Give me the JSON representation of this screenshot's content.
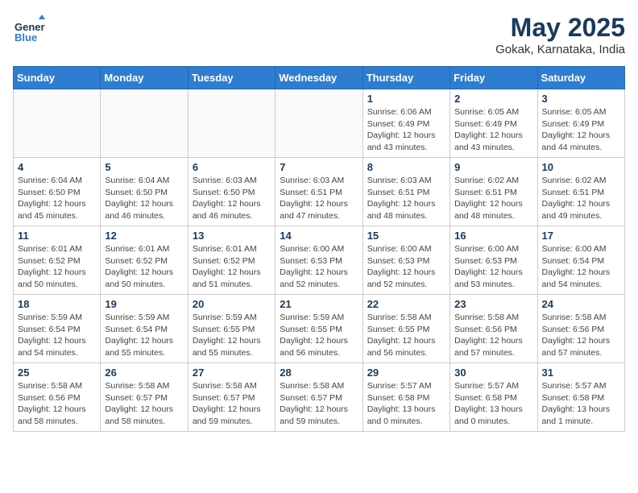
{
  "header": {
    "logo_general": "General",
    "logo_blue": "Blue",
    "month": "May 2025",
    "location": "Gokak, Karnataka, India"
  },
  "days_of_week": [
    "Sunday",
    "Monday",
    "Tuesday",
    "Wednesday",
    "Thursday",
    "Friday",
    "Saturday"
  ],
  "weeks": [
    [
      {
        "day": "",
        "info": ""
      },
      {
        "day": "",
        "info": ""
      },
      {
        "day": "",
        "info": ""
      },
      {
        "day": "",
        "info": ""
      },
      {
        "day": "1",
        "info": "Sunrise: 6:06 AM\nSunset: 6:49 PM\nDaylight: 12 hours\nand 43 minutes."
      },
      {
        "day": "2",
        "info": "Sunrise: 6:05 AM\nSunset: 6:49 PM\nDaylight: 12 hours\nand 43 minutes."
      },
      {
        "day": "3",
        "info": "Sunrise: 6:05 AM\nSunset: 6:49 PM\nDaylight: 12 hours\nand 44 minutes."
      }
    ],
    [
      {
        "day": "4",
        "info": "Sunrise: 6:04 AM\nSunset: 6:50 PM\nDaylight: 12 hours\nand 45 minutes."
      },
      {
        "day": "5",
        "info": "Sunrise: 6:04 AM\nSunset: 6:50 PM\nDaylight: 12 hours\nand 46 minutes."
      },
      {
        "day": "6",
        "info": "Sunrise: 6:03 AM\nSunset: 6:50 PM\nDaylight: 12 hours\nand 46 minutes."
      },
      {
        "day": "7",
        "info": "Sunrise: 6:03 AM\nSunset: 6:51 PM\nDaylight: 12 hours\nand 47 minutes."
      },
      {
        "day": "8",
        "info": "Sunrise: 6:03 AM\nSunset: 6:51 PM\nDaylight: 12 hours\nand 48 minutes."
      },
      {
        "day": "9",
        "info": "Sunrise: 6:02 AM\nSunset: 6:51 PM\nDaylight: 12 hours\nand 48 minutes."
      },
      {
        "day": "10",
        "info": "Sunrise: 6:02 AM\nSunset: 6:51 PM\nDaylight: 12 hours\nand 49 minutes."
      }
    ],
    [
      {
        "day": "11",
        "info": "Sunrise: 6:01 AM\nSunset: 6:52 PM\nDaylight: 12 hours\nand 50 minutes."
      },
      {
        "day": "12",
        "info": "Sunrise: 6:01 AM\nSunset: 6:52 PM\nDaylight: 12 hours\nand 50 minutes."
      },
      {
        "day": "13",
        "info": "Sunrise: 6:01 AM\nSunset: 6:52 PM\nDaylight: 12 hours\nand 51 minutes."
      },
      {
        "day": "14",
        "info": "Sunrise: 6:00 AM\nSunset: 6:53 PM\nDaylight: 12 hours\nand 52 minutes."
      },
      {
        "day": "15",
        "info": "Sunrise: 6:00 AM\nSunset: 6:53 PM\nDaylight: 12 hours\nand 52 minutes."
      },
      {
        "day": "16",
        "info": "Sunrise: 6:00 AM\nSunset: 6:53 PM\nDaylight: 12 hours\nand 53 minutes."
      },
      {
        "day": "17",
        "info": "Sunrise: 6:00 AM\nSunset: 6:54 PM\nDaylight: 12 hours\nand 54 minutes."
      }
    ],
    [
      {
        "day": "18",
        "info": "Sunrise: 5:59 AM\nSunset: 6:54 PM\nDaylight: 12 hours\nand 54 minutes."
      },
      {
        "day": "19",
        "info": "Sunrise: 5:59 AM\nSunset: 6:54 PM\nDaylight: 12 hours\nand 55 minutes."
      },
      {
        "day": "20",
        "info": "Sunrise: 5:59 AM\nSunset: 6:55 PM\nDaylight: 12 hours\nand 55 minutes."
      },
      {
        "day": "21",
        "info": "Sunrise: 5:59 AM\nSunset: 6:55 PM\nDaylight: 12 hours\nand 56 minutes."
      },
      {
        "day": "22",
        "info": "Sunrise: 5:58 AM\nSunset: 6:55 PM\nDaylight: 12 hours\nand 56 minutes."
      },
      {
        "day": "23",
        "info": "Sunrise: 5:58 AM\nSunset: 6:56 PM\nDaylight: 12 hours\nand 57 minutes."
      },
      {
        "day": "24",
        "info": "Sunrise: 5:58 AM\nSunset: 6:56 PM\nDaylight: 12 hours\nand 57 minutes."
      }
    ],
    [
      {
        "day": "25",
        "info": "Sunrise: 5:58 AM\nSunset: 6:56 PM\nDaylight: 12 hours\nand 58 minutes."
      },
      {
        "day": "26",
        "info": "Sunrise: 5:58 AM\nSunset: 6:57 PM\nDaylight: 12 hours\nand 58 minutes."
      },
      {
        "day": "27",
        "info": "Sunrise: 5:58 AM\nSunset: 6:57 PM\nDaylight: 12 hours\nand 59 minutes."
      },
      {
        "day": "28",
        "info": "Sunrise: 5:58 AM\nSunset: 6:57 PM\nDaylight: 12 hours\nand 59 minutes."
      },
      {
        "day": "29",
        "info": "Sunrise: 5:57 AM\nSunset: 6:58 PM\nDaylight: 13 hours\nand 0 minutes."
      },
      {
        "day": "30",
        "info": "Sunrise: 5:57 AM\nSunset: 6:58 PM\nDaylight: 13 hours\nand 0 minutes."
      },
      {
        "day": "31",
        "info": "Sunrise: 5:57 AM\nSunset: 6:58 PM\nDaylight: 13 hours\nand 1 minute."
      }
    ]
  ]
}
